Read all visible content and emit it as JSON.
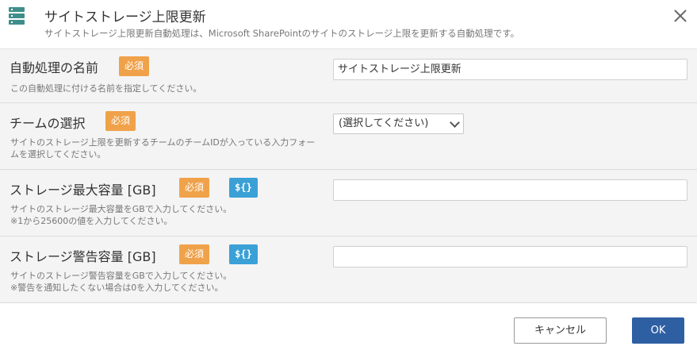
{
  "dialog": {
    "title": "サイトストレージ上限更新",
    "subtitle": "サイトストレージ上限更新自動処理は、Microsoft SharePointのサイトのストレージ上限を更新する自動処理です。",
    "icon": "server-stack-icon",
    "close_icon": "close-icon"
  },
  "fields": [
    {
      "label": "自動処理の名前",
      "required_badge": "必須",
      "description": "この自動処理に付ける名前を指定してください。",
      "value": "サイトストレージ上限更新"
    },
    {
      "label": "チームの選択",
      "required_badge": "必須",
      "description": "サイトのストレージ上限を更新するチームのチームIDが入っている入力フォームを選択してください。",
      "selected": "(選択してください)"
    },
    {
      "label": "ストレージ最大容量 [GB]",
      "required_badge": "必須",
      "variable_badge": "${}",
      "description_lines": [
        "サイトのストレージ最大容量をGBで入力してください。",
        "※1から25600の値を入力してください。"
      ],
      "value": ""
    },
    {
      "label": "ストレージ警告容量 [GB]",
      "required_badge": "必須",
      "variable_badge": "${}",
      "description_lines": [
        "サイトのストレージ警告容量をGBで入力してください。",
        "※警告を通知したくない場合は0を入力してください。"
      ],
      "value": ""
    }
  ],
  "footer": {
    "cancel_label": "キャンセル",
    "ok_label": "OK"
  },
  "colors": {
    "required": "#f0a24a",
    "variable": "#3aa0d6",
    "primary": "#2f5fa3",
    "icon": "#3f8e8a"
  }
}
